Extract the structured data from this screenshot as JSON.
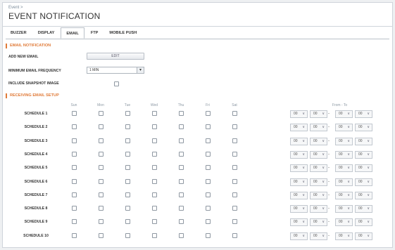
{
  "header": {
    "breadcrumb": "Event >",
    "title": "EVENT NOTIFICATION"
  },
  "tabs": [
    {
      "label": "BUZZER",
      "active": false
    },
    {
      "label": "DISPLAY",
      "active": false
    },
    {
      "label": "EMAIL",
      "active": true
    },
    {
      "label": "FTP",
      "active": false
    },
    {
      "label": "MOBILE PUSH",
      "active": false
    }
  ],
  "email_notification": {
    "section_title": "EMAIL NOTIFICATION",
    "add_new_email_label": "ADD NEW EMAIL",
    "edit_button": "EDIT",
    "min_frequency_label": "MINIMUM EMAIL FREQUENCY",
    "min_frequency_value": "1 MIN",
    "include_snapshot_label": "INCLUDE SNAPSHOT IMAGE",
    "include_snapshot_checked": false
  },
  "receiving": {
    "section_title": "RECEIVING EMAIL SETUP",
    "day_columns": [
      "Sun",
      "Mon",
      "Tue",
      "Wed",
      "Thu",
      "Fri",
      "Sat"
    ],
    "time_header": "From - To",
    "schedules": [
      {
        "label": "SCHEDULE 1",
        "days": [
          false,
          false,
          false,
          false,
          false,
          false,
          false
        ],
        "from_h": "00",
        "from_m": "00",
        "to_h": "00",
        "to_m": "00"
      },
      {
        "label": "SCHEDULE 2",
        "days": [
          false,
          false,
          false,
          false,
          false,
          false,
          false
        ],
        "from_h": "00",
        "from_m": "00",
        "to_h": "00",
        "to_m": "00"
      },
      {
        "label": "SCHEDULE 3",
        "days": [
          false,
          false,
          false,
          false,
          false,
          false,
          false
        ],
        "from_h": "00",
        "from_m": "00",
        "to_h": "00",
        "to_m": "00"
      },
      {
        "label": "SCHEDULE 4",
        "days": [
          false,
          false,
          false,
          false,
          false,
          false,
          false
        ],
        "from_h": "00",
        "from_m": "00",
        "to_h": "00",
        "to_m": "00"
      },
      {
        "label": "SCHEDULE 5",
        "days": [
          false,
          false,
          false,
          false,
          false,
          false,
          false
        ],
        "from_h": "00",
        "from_m": "00",
        "to_h": "00",
        "to_m": "00"
      },
      {
        "label": "SCHEDULE 6",
        "days": [
          false,
          false,
          false,
          false,
          false,
          false,
          false
        ],
        "from_h": "00",
        "from_m": "00",
        "to_h": "00",
        "to_m": "00"
      },
      {
        "label": "SCHEDULE 7",
        "days": [
          false,
          false,
          false,
          false,
          false,
          false,
          false
        ],
        "from_h": "00",
        "from_m": "00",
        "to_h": "00",
        "to_m": "00"
      },
      {
        "label": "SCHEDULE 8",
        "days": [
          false,
          false,
          false,
          false,
          false,
          false,
          false
        ],
        "from_h": "00",
        "from_m": "00",
        "to_h": "00",
        "to_m": "00"
      },
      {
        "label": "SCHEDULE 9",
        "days": [
          false,
          false,
          false,
          false,
          false,
          false,
          false
        ],
        "from_h": "00",
        "from_m": "00",
        "to_h": "00",
        "to_m": "00"
      },
      {
        "label": "SCHEDULE 10",
        "days": [
          false,
          false,
          false,
          false,
          false,
          false,
          false
        ],
        "from_h": "00",
        "from_m": "00",
        "to_h": "00",
        "to_m": "00"
      }
    ]
  },
  "colors": {
    "accent": "#e07b39",
    "border": "#cfd4da"
  }
}
